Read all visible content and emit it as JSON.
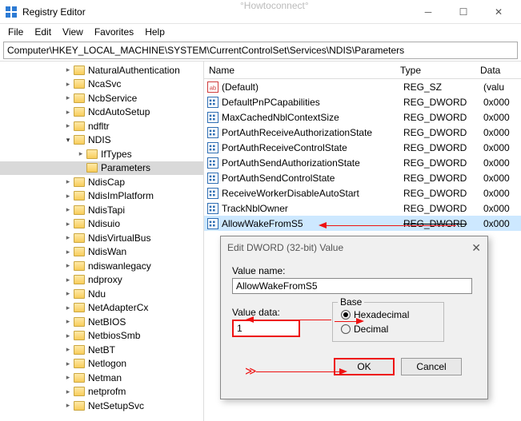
{
  "window": {
    "title": "Registry Editor",
    "watermark": "°Howtoconnect°"
  },
  "menu": [
    "File",
    "Edit",
    "View",
    "Favorites",
    "Help"
  ],
  "addressbar": "Computer\\HKEY_LOCAL_MACHINE\\SYSTEM\\CurrentControlSet\\Services\\NDIS\\Parameters",
  "listHeaders": {
    "name": "Name",
    "type": "Type",
    "data": "Data"
  },
  "tree": [
    {
      "indent": 5,
      "chev": "closed",
      "label": "NaturalAuthentication"
    },
    {
      "indent": 5,
      "chev": "closed",
      "label": "NcaSvc"
    },
    {
      "indent": 5,
      "chev": "closed",
      "label": "NcbService"
    },
    {
      "indent": 5,
      "chev": "closed",
      "label": "NcdAutoSetup"
    },
    {
      "indent": 5,
      "chev": "closed",
      "label": "ndfltr"
    },
    {
      "indent": 5,
      "chev": "open",
      "label": "NDIS"
    },
    {
      "indent": 6,
      "chev": "closed",
      "label": "IfTypes"
    },
    {
      "indent": 6,
      "chev": "none",
      "label": "Parameters",
      "selected": true
    },
    {
      "indent": 5,
      "chev": "closed",
      "label": "NdisCap"
    },
    {
      "indent": 5,
      "chev": "closed",
      "label": "NdisImPlatform"
    },
    {
      "indent": 5,
      "chev": "closed",
      "label": "NdisTapi"
    },
    {
      "indent": 5,
      "chev": "closed",
      "label": "Ndisuio"
    },
    {
      "indent": 5,
      "chev": "closed",
      "label": "NdisVirtualBus"
    },
    {
      "indent": 5,
      "chev": "closed",
      "label": "NdisWan"
    },
    {
      "indent": 5,
      "chev": "closed",
      "label": "ndiswanlegacy"
    },
    {
      "indent": 5,
      "chev": "closed",
      "label": "ndproxy"
    },
    {
      "indent": 5,
      "chev": "closed",
      "label": "Ndu"
    },
    {
      "indent": 5,
      "chev": "closed",
      "label": "NetAdapterCx"
    },
    {
      "indent": 5,
      "chev": "closed",
      "label": "NetBIOS"
    },
    {
      "indent": 5,
      "chev": "closed",
      "label": "NetbiosSmb"
    },
    {
      "indent": 5,
      "chev": "closed",
      "label": "NetBT"
    },
    {
      "indent": 5,
      "chev": "closed",
      "label": "Netlogon"
    },
    {
      "indent": 5,
      "chev": "closed",
      "label": "Netman"
    },
    {
      "indent": 5,
      "chev": "closed",
      "label": "netprofm"
    },
    {
      "indent": 5,
      "chev": "closed",
      "label": "NetSetupSvc"
    }
  ],
  "values": [
    {
      "icon": "str",
      "name": "(Default)",
      "type": "REG_SZ",
      "data": "(valu"
    },
    {
      "icon": "dw",
      "name": "DefaultPnPCapabilities",
      "type": "REG_DWORD",
      "data": "0x000"
    },
    {
      "icon": "dw",
      "name": "MaxCachedNblContextSize",
      "type": "REG_DWORD",
      "data": "0x000"
    },
    {
      "icon": "dw",
      "name": "PortAuthReceiveAuthorizationState",
      "type": "REG_DWORD",
      "data": "0x000"
    },
    {
      "icon": "dw",
      "name": "PortAuthReceiveControlState",
      "type": "REG_DWORD",
      "data": "0x000"
    },
    {
      "icon": "dw",
      "name": "PortAuthSendAuthorizationState",
      "type": "REG_DWORD",
      "data": "0x000"
    },
    {
      "icon": "dw",
      "name": "PortAuthSendControlState",
      "type": "REG_DWORD",
      "data": "0x000"
    },
    {
      "icon": "dw",
      "name": "ReceiveWorkerDisableAutoStart",
      "type": "REG_DWORD",
      "data": "0x000"
    },
    {
      "icon": "dw",
      "name": "TrackNblOwner",
      "type": "REG_DWORD",
      "data": "0x000"
    },
    {
      "icon": "dw",
      "name": "AllowWakeFromS5",
      "type": "REG_DWORD",
      "data": "0x000",
      "selected": true,
      "struck": true
    }
  ],
  "dialog": {
    "title": "Edit DWORD (32-bit) Value",
    "valueNameLabel": "Value name:",
    "valueName": "AllowWakeFromS5",
    "valueDataLabel": "Value data:",
    "valueData": "1",
    "baseLabel": "Base",
    "hexLabel": "Hexadecimal",
    "decLabel": "Decimal",
    "okLabel": "OK",
    "cancelLabel": "Cancel"
  }
}
